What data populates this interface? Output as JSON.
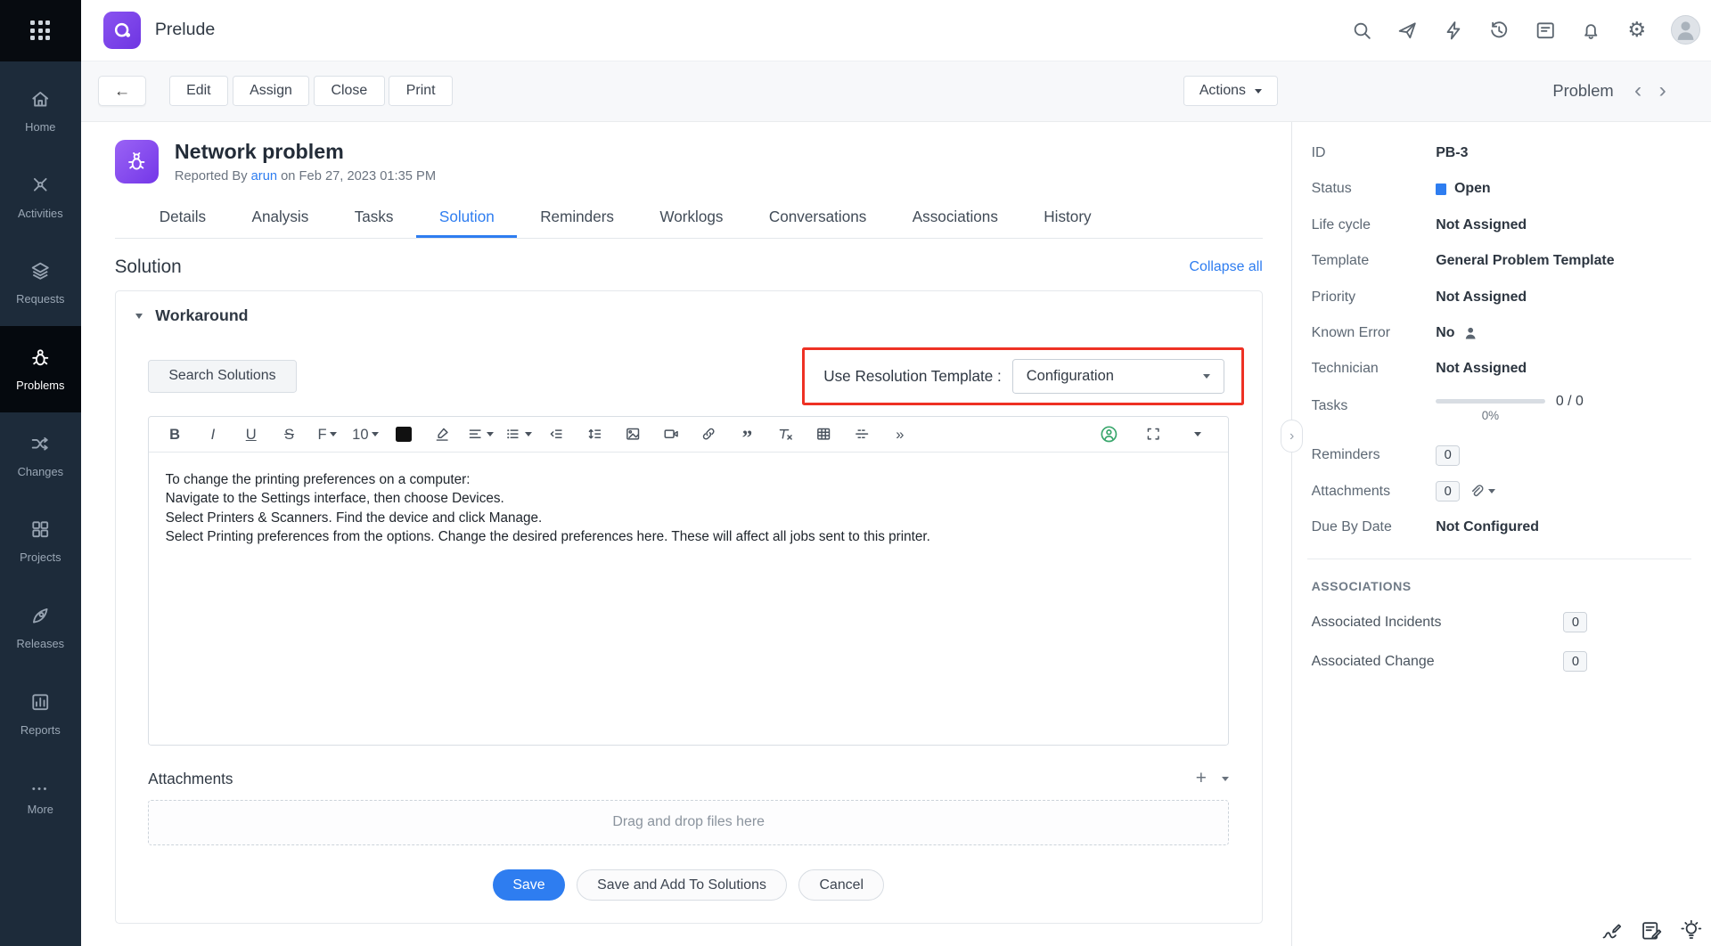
{
  "colors": {
    "accent": "#2e7df0",
    "annotation_red": "#ee3124",
    "brand_purple": "#7b42e9",
    "status_open": "#2e7df0"
  },
  "app": {
    "name": "Prelude"
  },
  "sidebar": {
    "items": [
      "Home",
      "Activities",
      "Requests",
      "Problems",
      "Changes",
      "Projects",
      "Releases",
      "Reports",
      "More"
    ],
    "active": "Problems"
  },
  "actionbar": {
    "back": "←",
    "buttons": [
      "Edit",
      "Assign",
      "Close",
      "Print"
    ],
    "actions": "Actions",
    "entity": "Problem",
    "prev": "‹",
    "next": "›"
  },
  "problem": {
    "title": "Network problem",
    "reported_by_label": "Reported By",
    "reporter": "arun",
    "reported_on": "on Feb 27, 2023 01:35 PM"
  },
  "tabs": [
    "Details",
    "Analysis",
    "Tasks",
    "Solution",
    "Reminders",
    "Worklogs",
    "Conversations",
    "Associations",
    "History"
  ],
  "active_tab": "Solution",
  "solution": {
    "heading": "Solution",
    "collapse_all": "Collapse all",
    "section": "Workaround",
    "search_button": "Search Solutions",
    "template_label": "Use Resolution Template :",
    "template_value": "Configuration",
    "editor": {
      "toolbar": {
        "bold": "B",
        "italic": "I",
        "underline": "U",
        "strike": "S",
        "font": "F",
        "size": "10",
        "quote": "”",
        "more": "»"
      },
      "lines": [
        "To change the printing preferences on a computer:",
        "Navigate to the Settings interface, then choose Devices.",
        "Select Printers & Scanners. Find the device and click Manage.",
        "Select Printing preferences from the options. Change the desired preferences here. These will affect all jobs sent to this printer."
      ]
    },
    "attachments_label": "Attachments",
    "attachments_add": "+",
    "dropzone": "Drag and drop files here",
    "save": "Save",
    "save_add": "Save and Add To Solutions",
    "cancel": "Cancel"
  },
  "panel": {
    "fields": {
      "id": {
        "label": "ID",
        "value": "PB-3"
      },
      "status": {
        "label": "Status",
        "value": "Open"
      },
      "lifecycle": {
        "label": "Life cycle",
        "value": "Not Assigned"
      },
      "template": {
        "label": "Template",
        "value": "General Problem Template"
      },
      "priority": {
        "label": "Priority",
        "value": "Not Assigned"
      },
      "known_error": {
        "label": "Known Error",
        "value": "No"
      },
      "technician": {
        "label": "Technician",
        "value": "Not Assigned"
      },
      "tasks": {
        "label": "Tasks",
        "count": "0 / 0",
        "percent": "0%"
      },
      "reminders": {
        "label": "Reminders",
        "count": "0"
      },
      "attachments": {
        "label": "Attachments",
        "count": "0"
      },
      "due_by": {
        "label": "Due By Date",
        "value": "Not Configured"
      }
    },
    "associations": {
      "heading": "ASSOCIATIONS",
      "incidents": {
        "label": "Associated Incidents",
        "count": "0"
      },
      "change": {
        "label": "Associated Change",
        "count": "0"
      }
    }
  },
  "glyphs": {
    "gear": "⚙",
    "more_dots": "•••",
    "collapse_handle": "›"
  }
}
